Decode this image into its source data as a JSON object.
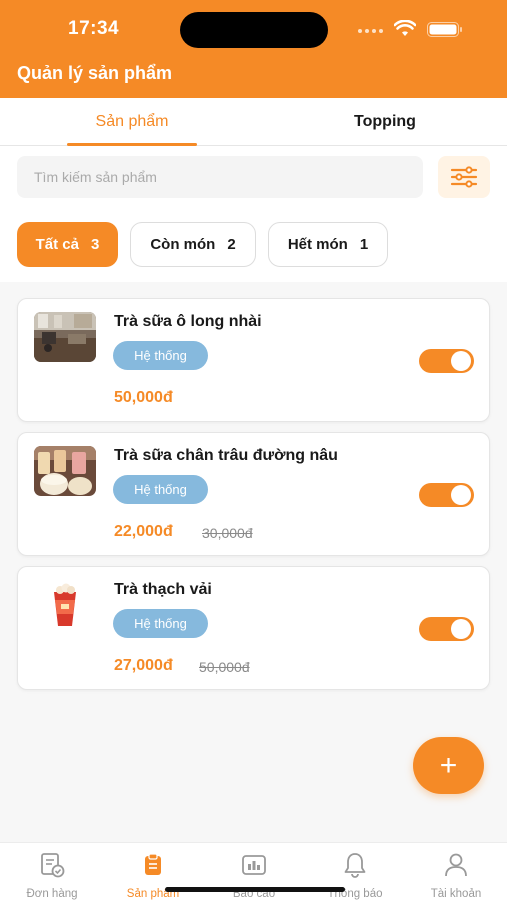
{
  "status_bar": {
    "time": "17:34"
  },
  "header": {
    "title": "Quản lý sản phẩm"
  },
  "tabs": [
    {
      "label": "Sản phẩm",
      "active": true
    },
    {
      "label": "Topping",
      "active": false
    }
  ],
  "search": {
    "placeholder": "Tìm kiếm sản phẩm",
    "value": ""
  },
  "filters": [
    {
      "label": "Tất cả",
      "count": "3",
      "active": true
    },
    {
      "label": "Còn món",
      "count": "2",
      "active": false
    },
    {
      "label": "Hết món",
      "count": "1",
      "active": false
    }
  ],
  "products": [
    {
      "name": "Trà sữa ô long nhài",
      "badge": "Hệ thống",
      "price": "50,000đ",
      "old_price": "",
      "available": true,
      "image": "milk-tea-shop-photo"
    },
    {
      "name": "Trà sữa chân trâu đường nâu",
      "badge": "Hệ thống",
      "price": "22,000đ",
      "old_price": "30,000đ",
      "available": true,
      "image": "milk-tea-cups-photo"
    },
    {
      "name": "Trà thạch vải",
      "badge": "Hệ thống",
      "price": "27,000đ",
      "old_price": "50,000đ",
      "available": true,
      "image": "lychee-jelly-tea-cup-photo"
    }
  ],
  "fab": {
    "label": "+"
  },
  "bottom_nav": [
    {
      "label": "Đơn hàng",
      "icon": "order-icon",
      "active": false
    },
    {
      "label": "Sản phẩm",
      "icon": "product-icon",
      "active": true
    },
    {
      "label": "Báo cáo",
      "icon": "report-icon",
      "active": false
    },
    {
      "label": "Thông báo",
      "icon": "bell-icon",
      "active": false
    },
    {
      "label": "Tài khoản",
      "icon": "user-icon",
      "active": false
    }
  ],
  "colors": {
    "accent": "#f58a26",
    "badge": "#86b9dd",
    "inactive": "#999999"
  }
}
